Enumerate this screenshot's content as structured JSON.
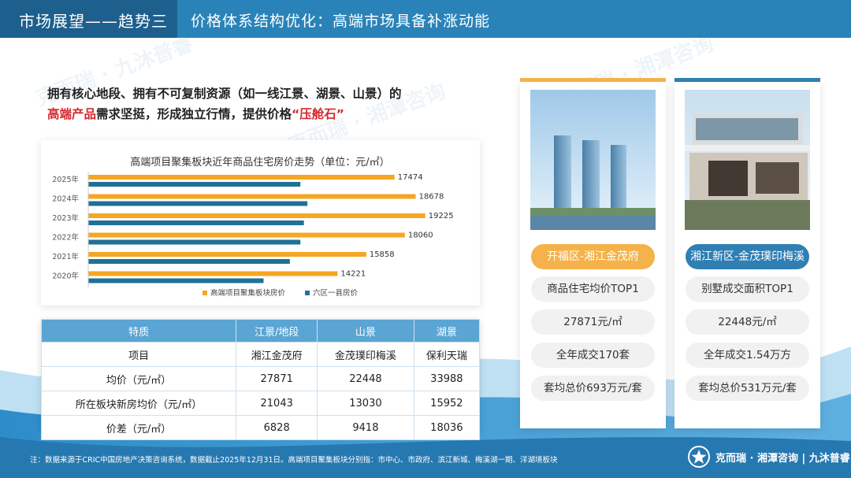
{
  "header": {
    "section": "市场展望——趋势三",
    "title": "价格体系结构优化：高端市场具备补涨动能"
  },
  "intro": {
    "line1": "拥有核心地段、拥有不可复制资源（如一线江景、湖景、山景）的",
    "line2_red": "高端产品",
    "line2_mid": "需求坚挺，形成独立行情，提供价格",
    "line2_quote": "“压舱石”"
  },
  "chart_data": {
    "type": "bar",
    "title": "高端项目聚集板块近年商品住宅房价走势（单位：元/㎡）",
    "categories": [
      "2025年",
      "2024年",
      "2023年",
      "2022年",
      "2021年",
      "2020年"
    ],
    "series": [
      {
        "name": "高端项目聚集板块房价",
        "values": [
          17474,
          18678,
          19225,
          18060,
          15858,
          14221
        ],
        "color": "#f5a623",
        "labels": [
          "17474",
          "18678",
          "19225",
          "18060",
          "15858",
          "14221"
        ]
      },
      {
        "name": "六区一县房价",
        "values": [
          12100,
          12500,
          12300,
          12100,
          11500,
          10000
        ],
        "color": "#1f7196"
      }
    ],
    "xlim": [
      0,
      20000
    ],
    "grid": false,
    "legend": "bottom"
  },
  "table": {
    "headers": [
      "特质",
      "江景/地段",
      "山景",
      "湖景"
    ],
    "rows": [
      [
        "项目",
        "湘江金茂府",
        "金茂璞印梅溪",
        "保利天瑞"
      ],
      [
        "均价（元/㎡）",
        "27871",
        "22448",
        "33988"
      ],
      [
        "所在板块新房均价（元/㎡）",
        "21043",
        "13030",
        "15952"
      ],
      [
        "价差（元/㎡）",
        "6828",
        "9418",
        "18036"
      ]
    ]
  },
  "cards": [
    {
      "highlight": "开福区-湘江金茂府",
      "items": [
        "商品住宅均价TOP1",
        "27871元/㎡",
        "全年成交170套",
        "套均总价693万元/套"
      ],
      "accent": "#f5b24a"
    },
    {
      "highlight": "湘江新区-金茂璞印梅溪",
      "items": [
        "别墅成交面积TOP1",
        "22448元/㎡",
        "全年成交1.54万方",
        "套均总价531万元/套"
      ],
      "accent": "#2f7fb3"
    }
  ],
  "footer": {
    "note": "注：数据来源于CRIC中国房地产决策咨询系统，数据截止2025年12月31日。高端项目聚集板块分别指：市中心、市政府、滨江新城、梅溪湖一期、洋湖境板块",
    "logo_text": "克而瑞 · 湘潭咨询 | 九沐普睿"
  }
}
